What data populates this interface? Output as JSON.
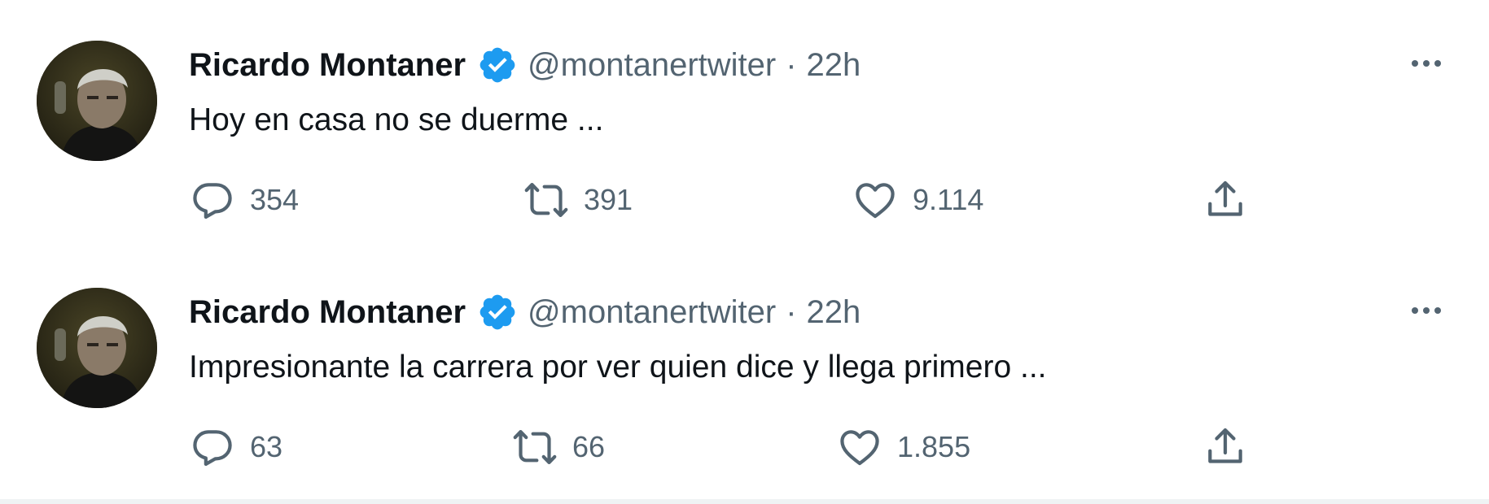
{
  "colors": {
    "text_primary": "#0f1419",
    "text_secondary": "#536471",
    "verified_blue": "#1d9bf0",
    "divider": "#eff3f4"
  },
  "tweets": [
    {
      "author_name": "Ricardo Montaner",
      "verified_icon": "verified-badge-icon",
      "handle": "@montanertwiter",
      "separator": "·",
      "time": "22h",
      "text": "Hoy en casa no se duerme ...",
      "reply_count": "354",
      "retweet_count": "391",
      "like_count": "9.114",
      "icons": [
        "reply-icon",
        "retweet-icon",
        "like-icon",
        "share-icon",
        "more-icon"
      ]
    },
    {
      "author_name": "Ricardo Montaner",
      "verified_icon": "verified-badge-icon",
      "handle": "@montanertwiter",
      "separator": "·",
      "time": "22h",
      "text": "Impresionante la carrera por ver quien dice y llega primero ...",
      "reply_count": "63",
      "retweet_count": "66",
      "like_count": "1.855",
      "icons": [
        "reply-icon",
        "retweet-icon",
        "like-icon",
        "share-icon",
        "more-icon"
      ]
    }
  ]
}
